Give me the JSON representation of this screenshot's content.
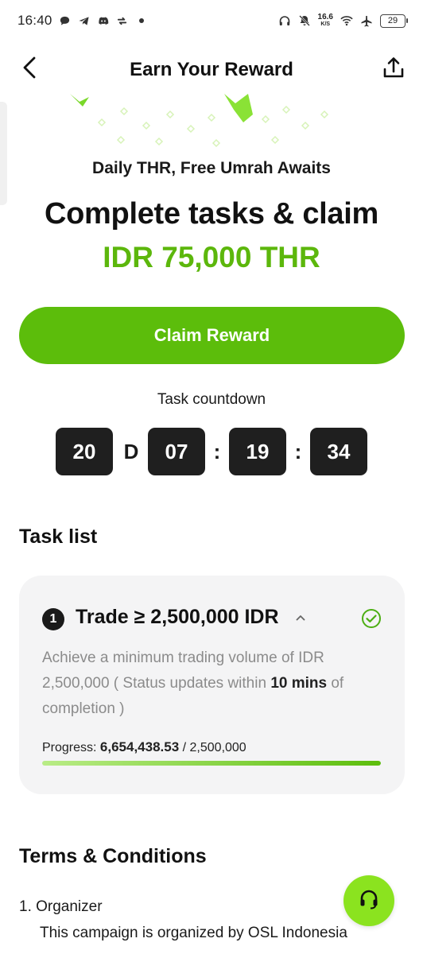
{
  "status_bar": {
    "time": "16:40",
    "net_speed": "16.6",
    "net_unit": "K/S",
    "battery": "29"
  },
  "header": {
    "title": "Earn Your Reward",
    "back_icon": "chevron-left-icon",
    "share_icon": "share-icon"
  },
  "hero": {
    "subtitle": "Daily THR, Free Umrah Awaits",
    "headline": "Complete tasks & claim",
    "amount": "IDR 75,000 THR"
  },
  "claim_button": "Claim Reward",
  "countdown": {
    "label": "Task countdown",
    "days": "20",
    "days_unit": "D",
    "hours": "07",
    "minutes": "19",
    "seconds": "34",
    "separator": ":"
  },
  "task_list": {
    "title": "Task list",
    "tasks": [
      {
        "number": "1",
        "title": "Trade ≥ 2,500,000 IDR",
        "desc_prefix": "Achieve a minimum trading volume of IDR 2,500,000 ( Status updates within ",
        "desc_bold": "10 mins",
        "desc_suffix": " of completion )",
        "progress_label": "Progress:",
        "progress_current": "6,654,438.53",
        "progress_target": " / 2,500,000",
        "progress_fraction": 1.0,
        "completed": true
      }
    ]
  },
  "terms": {
    "title": "Terms & Conditions",
    "item_1_title": "1. Organizer",
    "item_1_text": "This campaign is organized by OSL Indonesia"
  },
  "colors": {
    "accent": "#5cbd0b",
    "amount": "#5cb70c",
    "fab": "#8be31f"
  }
}
